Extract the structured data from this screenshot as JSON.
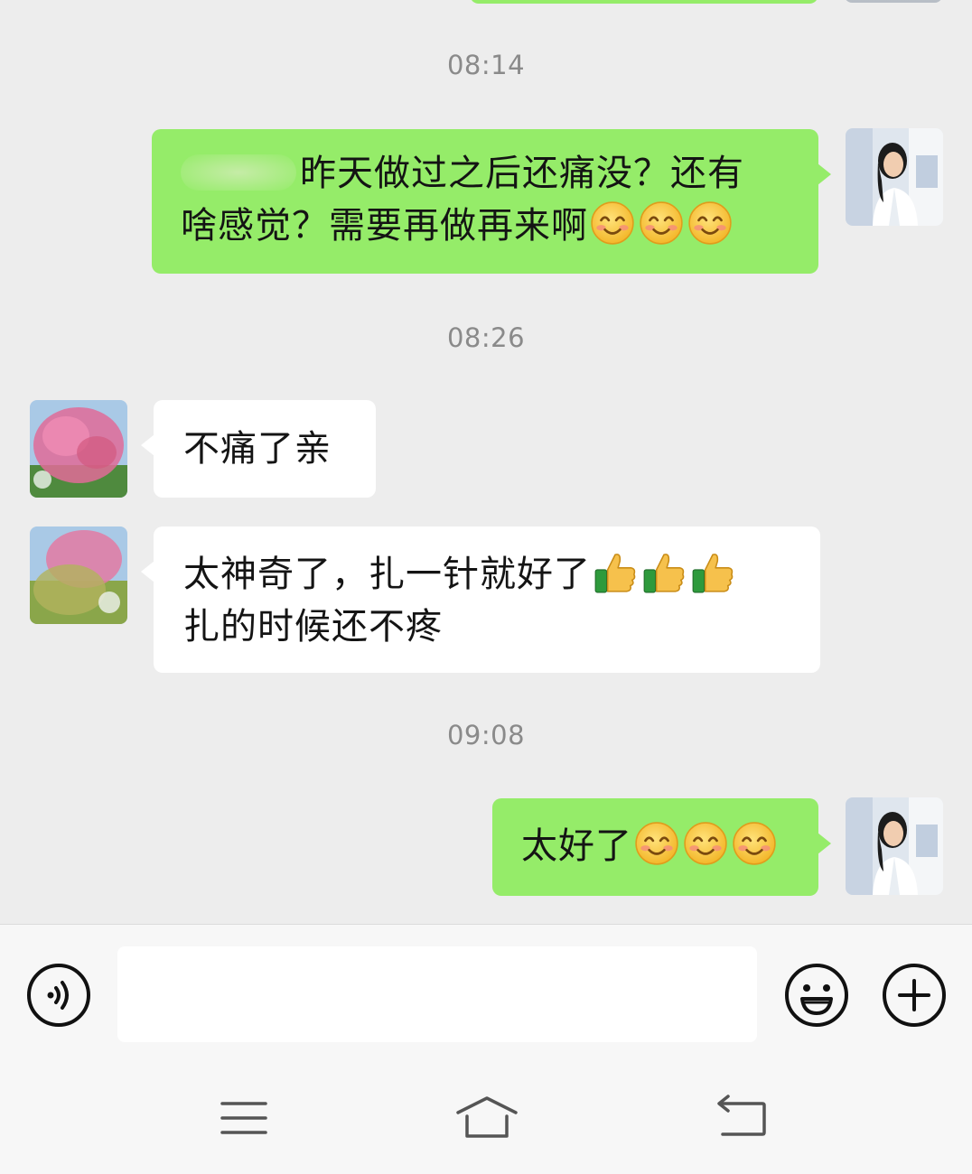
{
  "messages": [
    {
      "type": "time",
      "text": "08:14"
    },
    {
      "type": "outgoing",
      "line1": "昨天做过之后还痛没？还有",
      "line2": "啥感觉？需要再做再来啊",
      "emoji": [
        "smiling-face",
        "smiling-face",
        "smiling-face"
      ]
    },
    {
      "type": "time",
      "text": "08:26"
    },
    {
      "type": "incoming",
      "text": "不痛了亲"
    },
    {
      "type": "incoming",
      "line1": "太神奇了，扎一针就好了",
      "line2": "扎的时候还不疼",
      "emoji": [
        "thumbs-up",
        "thumbs-up",
        "thumbs-up"
      ]
    },
    {
      "type": "time",
      "text": "09:08"
    },
    {
      "type": "outgoing",
      "text": "太好了",
      "emoji": [
        "smiling-face",
        "smiling-face",
        "smiling-face"
      ]
    }
  ],
  "input": {
    "placeholder": "",
    "value": ""
  },
  "toolbar": {
    "left": "voice-icon",
    "right": [
      "emoji-icon",
      "plus-icon"
    ]
  },
  "navbar": [
    "menu-icon",
    "home-icon",
    "back-icon"
  ],
  "colors": {
    "background": "#ededed",
    "outgoing_bubble": "#95ec69",
    "incoming_bubble": "#ffffff",
    "timestamp": "#8a8a8a"
  }
}
